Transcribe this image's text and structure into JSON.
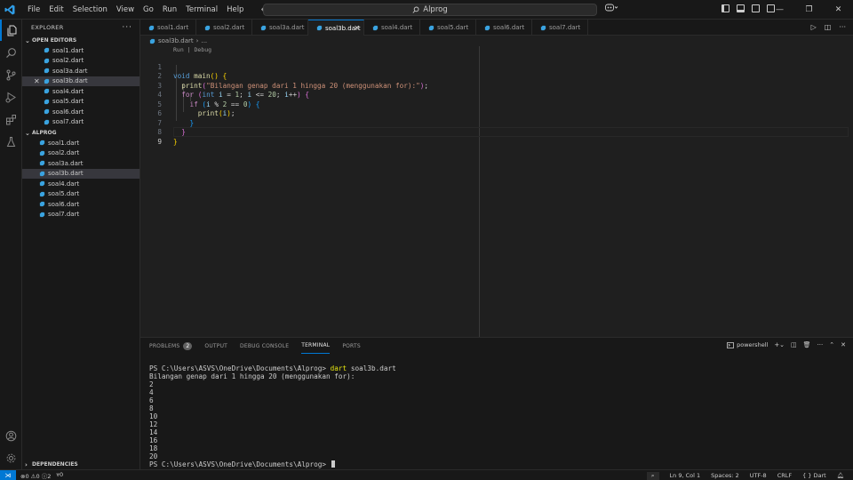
{
  "titlebar": {
    "menu": [
      "File",
      "Edit",
      "Selection",
      "View",
      "Go",
      "Run",
      "Terminal",
      "Help"
    ],
    "search_text": "Alprog"
  },
  "sidebar": {
    "header": "EXPLORER",
    "open_editors_title": "OPEN EDITORS",
    "open_editors": [
      "soal1.dart",
      "soal2.dart",
      "soal3a.dart",
      "soal3b.dart",
      "soal4.dart",
      "soal5.dart",
      "soal6.dart",
      "soal7.dart"
    ],
    "project_title": "ALPROG",
    "project_files": [
      "soal1.dart",
      "soal2.dart",
      "soal3a.dart",
      "soal3b.dart",
      "soal4.dart",
      "soal5.dart",
      "soal6.dart",
      "soal7.dart"
    ],
    "dependencies_title": "DEPENDENCIES"
  },
  "tabs": [
    "soal1.dart",
    "soal2.dart",
    "soal3a.dart",
    "soal3b.dart",
    "soal4.dart",
    "soal5.dart",
    "soal6.dart",
    "soal7.dart"
  ],
  "breadcrumb": {
    "file": "soal3b.dart",
    "rest": "..."
  },
  "editor": {
    "codelens": "Run | Debug",
    "line_numbers": [
      "1",
      "2",
      "3",
      "4",
      "5",
      "6",
      "7",
      "8",
      "9"
    ],
    "code": {
      "l1_kw": "void",
      "l1_fn": "main",
      "l1_rest": "() {",
      "l2_fn": "print",
      "l2_str": "\"Bilangan genap dari 1 hingga 20 (menggunakan for):\"",
      "l3_kw": "for",
      "l3_int": "int",
      "l3_i": "i",
      "l3_one": "1",
      "l3_i2": "i",
      "l3_twenty": "20",
      "l3_i3": "i",
      "l4_kw": "if",
      "l4_i": "i",
      "l4_two": "2",
      "l4_zero": "0",
      "l5_fn": "print",
      "l5_i": "i"
    }
  },
  "panel": {
    "tabs": [
      "PROBLEMS",
      "OUTPUT",
      "DEBUG CONSOLE",
      "TERMINAL",
      "PORTS"
    ],
    "problems_count": "2",
    "shell_name": "powershell",
    "terminal": {
      "prompt": "PS C:\\Users\\ASVS\\OneDrive\\Documents\\Alprog>",
      "command": "dart",
      "command_arg": "soal3b.dart",
      "output_header": "Bilangan genap dari 1 hingga 20 (menggunakan for):",
      "output": [
        "2",
        "4",
        "6",
        "8",
        "10",
        "12",
        "14",
        "16",
        "18",
        "20"
      ],
      "final_prompt": "PS C:\\Users\\ASVS\\OneDrive\\Documents\\Alprog>"
    }
  },
  "statusbar": {
    "errors": "0",
    "warnings": "0",
    "infos": "2",
    "ports": "0",
    "position": "Ln 9, Col 1",
    "spaces": "Spaces: 2",
    "encoding": "UTF-8",
    "eol": "CRLF",
    "language": "Dart"
  },
  "colors": {
    "accent": "#0078d4",
    "background": "#1f1f1f",
    "sidebar": "#181818"
  }
}
